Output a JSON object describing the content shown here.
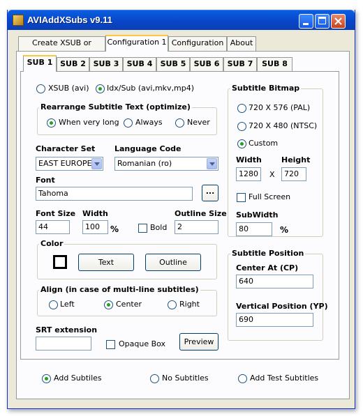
{
  "window": {
    "title": "AVIAddXSubs v9.11"
  },
  "main_tabs": [
    "Create XSUB or Idx/Sub",
    "Configuration 1",
    "Configuration 2",
    "About"
  ],
  "sub_tabs": [
    "SUB 1",
    "SUB 2",
    "SUB 3",
    "SUB 4",
    "SUB 5",
    "SUB 6",
    "SUB 7",
    "SUB 8"
  ],
  "format": {
    "xsub": "XSUB (avi)",
    "idxsub": "Idx/Sub (avi,mkv,mp4)",
    "selected": "Idx/Sub (avi,mkv,mp4)"
  },
  "rearrange": {
    "title": "Rearrange Subtitle Text (optimize)",
    "when_very_long": "When very long",
    "always": "Always",
    "never": "Never",
    "selected": "When very long"
  },
  "charset": {
    "label": "Character Set",
    "value": "EAST EUROPE"
  },
  "language": {
    "label": "Language Code",
    "value": "Romanian (ro)"
  },
  "font": {
    "label": "Font",
    "value": "Tahoma",
    "browse": "..."
  },
  "font_size": {
    "label": "Font Size",
    "value": "44"
  },
  "width": {
    "label": "Width",
    "value": "100",
    "unit": "%"
  },
  "bold": {
    "label": "Bold",
    "checked": false
  },
  "outline_size": {
    "label": "Outline Size",
    "value": "2"
  },
  "color": {
    "title": "Color",
    "text_button": "Text",
    "outline_button": "Outline",
    "swatch": "#ffffff"
  },
  "align": {
    "title": "Align (in case of multi-line subtitles)",
    "left": "Left",
    "center": "Center",
    "right": "Right",
    "selected": "Center"
  },
  "srt": {
    "label": "SRT extension",
    "value": ""
  },
  "opaque_box": {
    "label": "Opaque Box",
    "checked": false
  },
  "preview_button": "Preview",
  "bitmap": {
    "title": "Subtitle Bitmap",
    "pal": "720 X 576 (PAL)",
    "ntsc": "720 X 480 (NTSC)",
    "custom": "Custom",
    "selected": "Custom",
    "width_label": "Width",
    "height_label": "Height",
    "width": "1280",
    "x": "X",
    "height": "720",
    "full_screen": "Full Screen",
    "subwidth_label": "SubWidth",
    "subwidth": "80",
    "subwidth_unit": "%"
  },
  "position": {
    "title": "Subtitle Position",
    "center_label": "Center At (CP)",
    "center_value": "640",
    "vertical_label": "Vertical Position (YP)",
    "vertical_value": "690"
  },
  "bottom": {
    "add_subtitles": "Add Subtiles",
    "no_subtitles": "No Subtitles",
    "add_test": "Add Test Subtitles",
    "selected": "Add Subtiles"
  }
}
